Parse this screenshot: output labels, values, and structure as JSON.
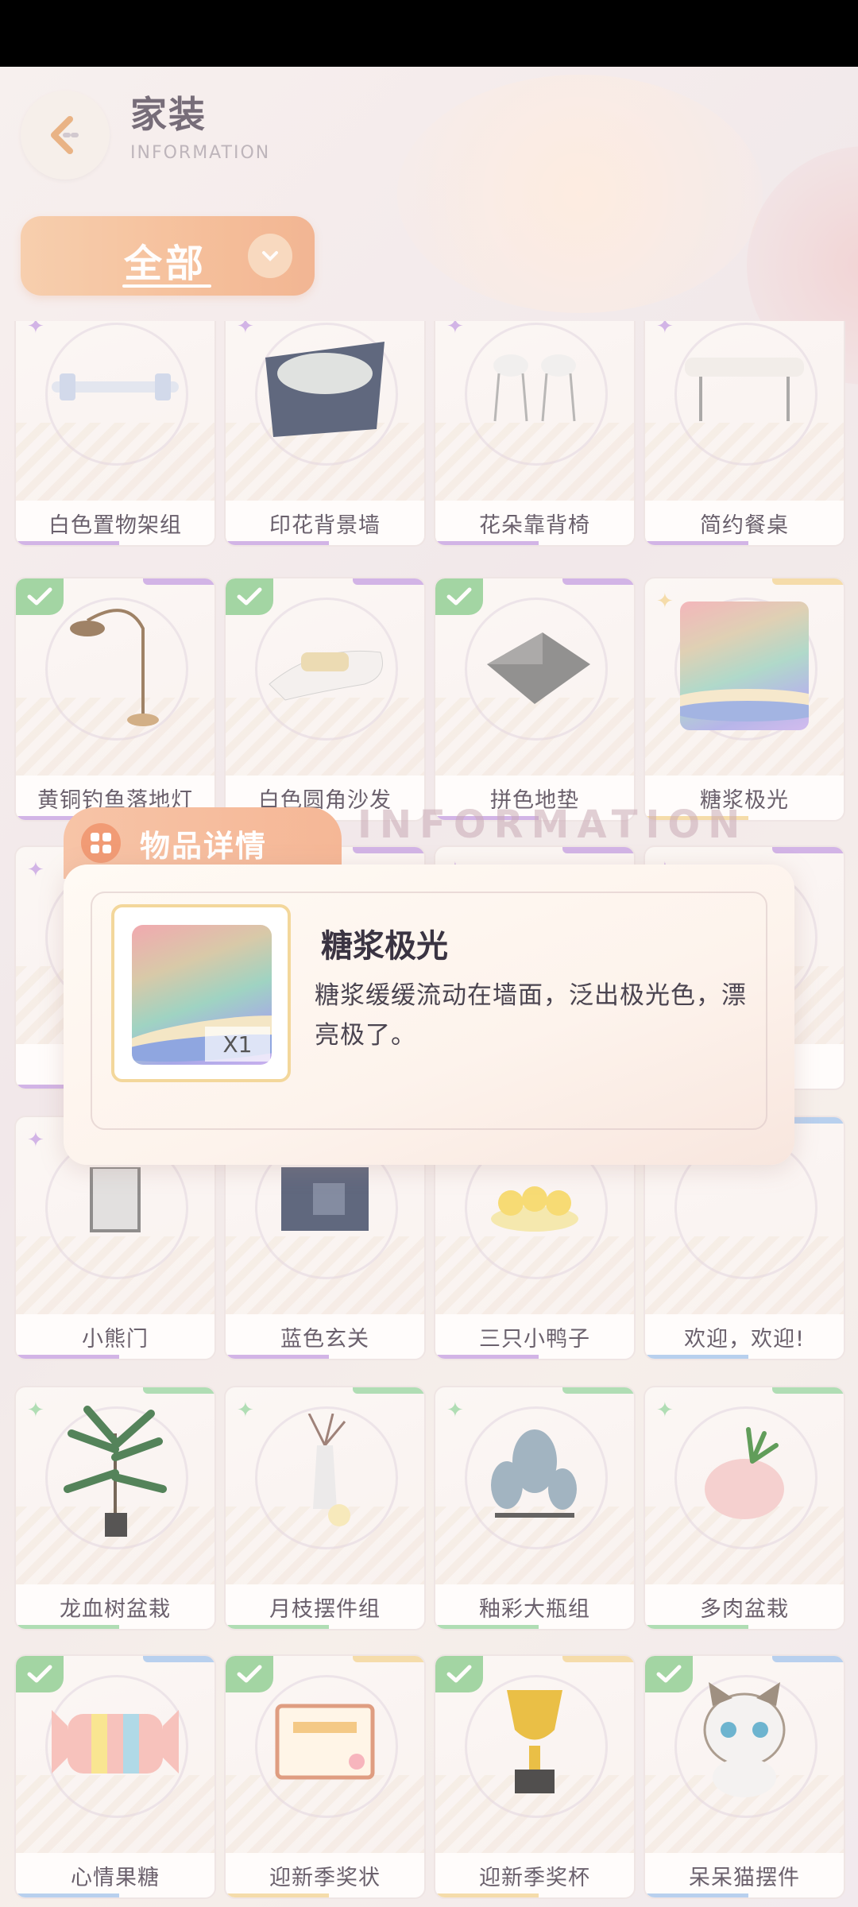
{
  "header": {
    "title": "家装",
    "subtitle": "INFORMATION"
  },
  "filter": {
    "selected": "全部"
  },
  "grid": {
    "rows": [
      [
        {
          "label": "白色置物架组",
          "owned": false,
          "rarity": "purple"
        },
        {
          "label": "印花背景墙",
          "owned": false,
          "rarity": "purple"
        },
        {
          "label": "花朵靠背椅",
          "owned": false,
          "rarity": "purple"
        },
        {
          "label": "简约餐桌",
          "owned": false,
          "rarity": "purple"
        }
      ],
      [
        {
          "label": "黄铜钓鱼落地灯",
          "owned": true,
          "rarity": "purple"
        },
        {
          "label": "白色圆角沙发",
          "owned": true,
          "rarity": "purple"
        },
        {
          "label": "拼色地垫",
          "owned": true,
          "rarity": "purple"
        },
        {
          "label": "糖浆极光",
          "owned": false,
          "rarity": "gold"
        }
      ],
      [
        {
          "label": "黄",
          "owned": false,
          "rarity": "purple"
        },
        {
          "label": "",
          "owned": false,
          "rarity": "purple"
        },
        {
          "label": "",
          "owned": false,
          "rarity": "purple"
        },
        {
          "label": "几",
          "owned": false,
          "rarity": "purple"
        }
      ],
      [
        {
          "label": "小熊门",
          "owned": false,
          "rarity": "purple"
        },
        {
          "label": "蓝色玄关",
          "owned": false,
          "rarity": "purple"
        },
        {
          "label": "三只小鸭子",
          "owned": false,
          "rarity": "purple"
        },
        {
          "label": "欢迎，欢迎!",
          "owned": false,
          "rarity": "blue"
        }
      ],
      [
        {
          "label": "龙血树盆栽",
          "owned": false,
          "rarity": "green"
        },
        {
          "label": "月枝摆件组",
          "owned": false,
          "rarity": "green"
        },
        {
          "label": "釉彩大瓶组",
          "owned": false,
          "rarity": "green"
        },
        {
          "label": "多肉盆栽",
          "owned": false,
          "rarity": "green"
        }
      ],
      [
        {
          "label": "心情果糖",
          "owned": true,
          "rarity": "blue"
        },
        {
          "label": "迎新季奖状",
          "owned": true,
          "rarity": "gold"
        },
        {
          "label": "迎新季奖杯",
          "owned": true,
          "rarity": "gold"
        },
        {
          "label": "呆呆猫摆件",
          "owned": true,
          "rarity": "blue"
        }
      ]
    ]
  },
  "modal": {
    "tab_label": "物品详情",
    "watermark": "INFORMATION",
    "item_name": "糖浆极光",
    "item_count": "X1",
    "item_description": "糖浆缓缓流动在墙面，泛出极光色，漂亮极了。"
  },
  "colors": {
    "accent": "#f3b489",
    "owned_badge": "#8fcf93",
    "purple": "#c9a6e4",
    "gold": "#f3d79b",
    "blue": "#a9c8ee",
    "green": "#9fd8a8"
  }
}
